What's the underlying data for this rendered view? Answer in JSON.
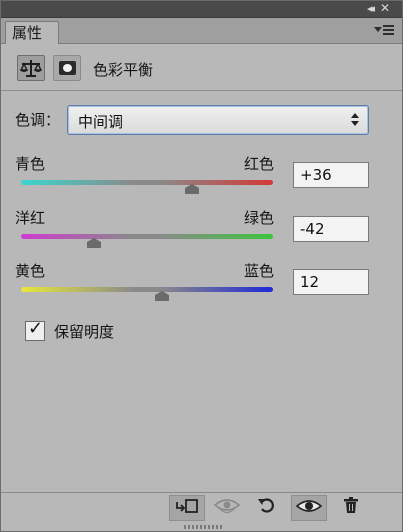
{
  "panel": {
    "tab_label": "属性",
    "collapse_glyph": "◂◂",
    "close_glyph": "✕",
    "menu_icon": "panel-menu-icon"
  },
  "header": {
    "title": "色彩平衡",
    "icons": [
      "balance-scale-icon",
      "layer-mask-icon"
    ]
  },
  "tone": {
    "label": "色调：",
    "selected": "中间调"
  },
  "sliders": [
    {
      "left_label": "青色",
      "right_label": "红色",
      "value": "+36",
      "level": 36,
      "range": [
        -100,
        100
      ],
      "gradient": [
        "#3ad6cf",
        "#d43838"
      ]
    },
    {
      "left_label": "洋红",
      "right_label": "绿色",
      "value": "-42",
      "level": -42,
      "range": [
        -100,
        100
      ],
      "gradient": [
        "#cf3ccf",
        "#3cc43c"
      ]
    },
    {
      "left_label": "黄色",
      "right_label": "蓝色",
      "value": "12",
      "level": 12,
      "range": [
        -100,
        100
      ],
      "gradient": [
        "#e8e83a",
        "#1f2ad6"
      ]
    }
  ],
  "preserve": {
    "label": "保留明度",
    "checked": true,
    "mark": "✓"
  },
  "bottom_toolbar": [
    {
      "name": "clip-to-layer-button",
      "icon": "clip-to-layer-icon",
      "glyph": "⬐☐",
      "pressed": true,
      "dim": false
    },
    {
      "name": "view-previous-state-button",
      "icon": "eye-previous-icon",
      "glyph": "👁",
      "pressed": false,
      "dim": true
    },
    {
      "name": "reset-button",
      "icon": "reset-icon",
      "glyph": "↺",
      "pressed": false,
      "dim": false
    },
    {
      "name": "toggle-visibility-button",
      "icon": "eye-icon",
      "glyph": "👁",
      "pressed": true,
      "dim": false
    },
    {
      "name": "delete-button",
      "icon": "trash-icon",
      "glyph": "🗑",
      "pressed": false,
      "dim": false
    }
  ]
}
